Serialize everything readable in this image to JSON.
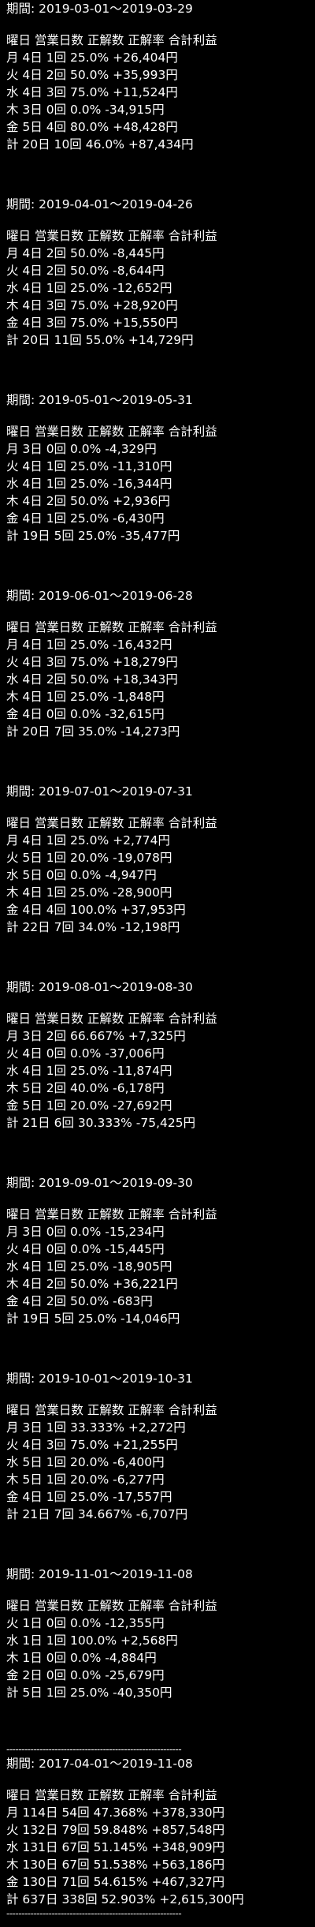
{
  "colors": {
    "background": "#000000",
    "text": "#ffffff"
  },
  "header_label": "曜日 営業日数 正解数 正解率 合計利益",
  "divider": "----------------------------------------------------------",
  "blocks": [
    {
      "period": "期間: 2019-03-01～2019-03-29",
      "rows": [
        "月 4日 1回 25.0% +26,404円",
        "火 4日 2回 50.0% +35,993円",
        "水 4日 3回 75.0% +11,524円",
        "木 3日 0回 0.0% -34,915円",
        "金 5日 4回 80.0% +48,428円",
        "計 20日 10回 46.0% +87,434円"
      ]
    },
    {
      "period": "期間: 2019-04-01～2019-04-26",
      "rows": [
        "月 4日 2回 50.0% -8,445円",
        "火 4日 2回 50.0% -8,644円",
        "水 4日 1回 25.0% -12,652円",
        "木 4日 3回 75.0% +28,920円",
        "金 4日 3回 75.0% +15,550円",
        "計 20日 11回 55.0% +14,729円"
      ]
    },
    {
      "period": "期間: 2019-05-01～2019-05-31",
      "rows": [
        "月 3日 0回 0.0% -4,329円",
        "火 4日 1回 25.0% -11,310円",
        "水 4日 1回 25.0% -16,344円",
        "木 4日 2回 50.0% +2,936円",
        "金 4日 1回 25.0% -6,430円",
        "計 19日 5回 25.0% -35,477円"
      ]
    },
    {
      "period": "期間: 2019-06-01～2019-06-28",
      "rows": [
        "月 4日 1回 25.0% -16,432円",
        "火 4日 3回 75.0% +18,279円",
        "水 4日 2回 50.0% +18,343円",
        "木 4日 1回 25.0% -1,848円",
        "金 4日 0回 0.0% -32,615円",
        "計 20日 7回 35.0% -14,273円"
      ]
    },
    {
      "period": "期間: 2019-07-01～2019-07-31",
      "rows": [
        "月 4日 1回 25.0% +2,774円",
        "火 5日 1回 20.0% -19,078円",
        "水 5日 0回 0.0% -4,947円",
        "木 4日 1回 25.0% -28,900円",
        "金 4日 4回 100.0% +37,953円",
        "計 22日 7回 34.0% -12,198円"
      ]
    },
    {
      "period": "期間: 2019-08-01～2019-08-30",
      "rows": [
        "月 3日 2回 66.667% +7,325円",
        "火 4日 0回 0.0% -37,006円",
        "水 4日 1回 25.0% -11,874円",
        "木 5日 2回 40.0% -6,178円",
        "金 5日 1回 20.0% -27,692円",
        "計 21日 6回 30.333% -75,425円"
      ]
    },
    {
      "period": "期間: 2019-09-01～2019-09-30",
      "rows": [
        "月 3日 0回 0.0% -15,234円",
        "火 4日 0回 0.0% -15,445円",
        "水 4日 1回 25.0% -18,905円",
        "木 4日 2回 50.0% +36,221円",
        "金 4日 2回 50.0% -683円",
        "計 19日 5回 25.0% -14,046円"
      ]
    },
    {
      "period": "期間: 2019-10-01～2019-10-31",
      "rows": [
        "月 3日 1回 33.333% +2,272円",
        "火 4日 3回 75.0% +21,255円",
        "水 5日 1回 20.0% -6,400円",
        "木 5日 1回 20.0% -6,277円",
        "金 4日 1回 25.0% -17,557円",
        "計 21日 7回 34.667% -6,707円"
      ]
    },
    {
      "period": "期間: 2019-11-01～2019-11-08",
      "rows": [
        "火 1日 0回 0.0% -12,355円",
        "水 1日 1回 100.0% +2,568円",
        "木 1日 0回 0.0% -4,884円",
        "金 2日 0回 0.0% -25,679円",
        "計 5日 1回 25.0% -40,350円"
      ]
    }
  ],
  "summary": {
    "period": "期間: 2017-04-01～2019-11-08",
    "rows": [
      "月 114日 54回 47.368% +378,330円",
      "火 132日 79回 59.848% +857,548円",
      "水 131日 67回 51.145% +348,909円",
      "木 130日 67回 51.538% +563,186円",
      "金 130日 71回 54.615% +467,327円",
      "計 637日 338回 52.903% +2,615,300円"
    ]
  }
}
